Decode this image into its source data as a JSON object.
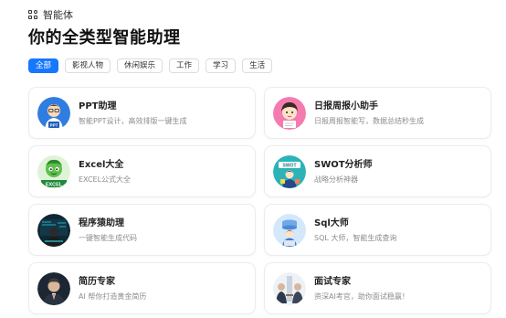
{
  "header": {
    "label": "智能体"
  },
  "page": {
    "title": "你的全类型智能助理"
  },
  "tabs": [
    {
      "label": "全部",
      "active": true
    },
    {
      "label": "影视人物",
      "active": false
    },
    {
      "label": "休闲娱乐",
      "active": false
    },
    {
      "label": "工作",
      "active": false
    },
    {
      "label": "学习",
      "active": false
    },
    {
      "label": "生活",
      "active": false
    }
  ],
  "cards": [
    {
      "title": "PPT助理",
      "desc": "智能PPT设计，高效排版一键生成",
      "avatar": "ppt-avatar-icon",
      "avatar_text": "PPT"
    },
    {
      "title": "日报周报小助手",
      "desc": "日报周报智能写，数据总结秒生成",
      "avatar": "report-avatar-icon"
    },
    {
      "title": "Excel大全",
      "desc": "EXCEL公式大全",
      "avatar": "excel-avatar-icon",
      "avatar_text": "EXCEL"
    },
    {
      "title": "SWOT分析师",
      "desc": "战略分析神器",
      "avatar": "swot-avatar-icon",
      "avatar_text": "SWOT"
    },
    {
      "title": "程序猿助理",
      "desc": "一键智能生成代码",
      "avatar": "coder-avatar-icon"
    },
    {
      "title": "Sql大师",
      "desc": "SQL 大师，智能生成查询",
      "avatar": "sql-avatar-icon"
    },
    {
      "title": "简历专家",
      "desc": "AI 帮你打造黄金简历",
      "avatar": "resume-avatar-icon"
    },
    {
      "title": "面试专家",
      "desc": "资深AI考官，助你面试稳赢！",
      "avatar": "interview-avatar-icon"
    }
  ],
  "colors": {
    "accent": "#1677ff",
    "card_border": "#ececec",
    "desc_text": "#8c8c8c"
  }
}
